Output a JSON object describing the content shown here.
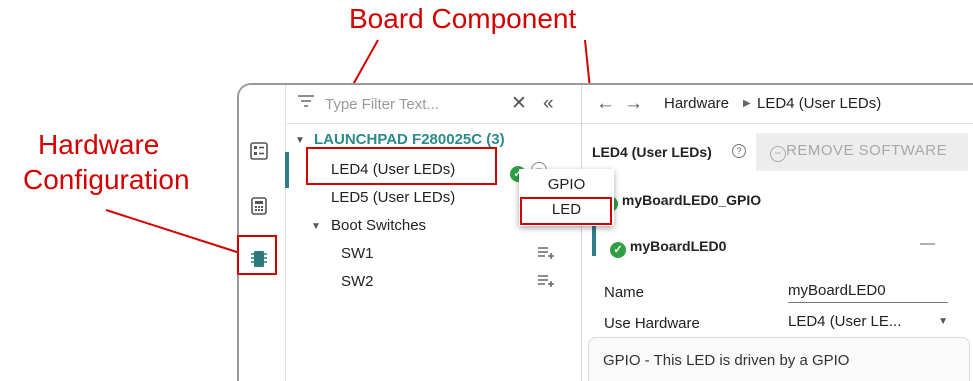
{
  "annotations": {
    "board_component": "Board Component",
    "hardware_configuration_line1": "Hardware",
    "hardware_configuration_line2": "Configuration"
  },
  "filter": {
    "placeholder": "Type Filter Text..."
  },
  "tree": {
    "root": "LAUNCHPAD F280025C (3)",
    "items": [
      {
        "label": "LED4 (User LEDs)",
        "selected": true
      },
      {
        "label": "LED5 (User LEDs)"
      },
      {
        "label": "Boot Switches",
        "children": [
          "SW1",
          "SW2"
        ]
      }
    ]
  },
  "popup": {
    "options": [
      "GPIO",
      "LED"
    ],
    "highlighted": "LED"
  },
  "breadcrumb": {
    "root": "Hardware",
    "current": "LED4 (User LEDs)"
  },
  "details": {
    "title": "LED4 (User LEDs)",
    "remove_button": "REMOVE SOFTWARE",
    "instance_gpio": "myBoardLED0_GPIO",
    "instance_led": "myBoardLED0",
    "collapse_symbol": "—",
    "fields": {
      "name_label": "Name",
      "name_value": "myBoardLED0",
      "use_hw_label": "Use Hardware",
      "use_hw_value": "LED4 (User LE..."
    },
    "info_text": "GPIO - This LED is driven by a GPIO"
  },
  "colors": {
    "accent": "#2e7f87",
    "annotation": "#d40000",
    "success": "#2ea043"
  }
}
